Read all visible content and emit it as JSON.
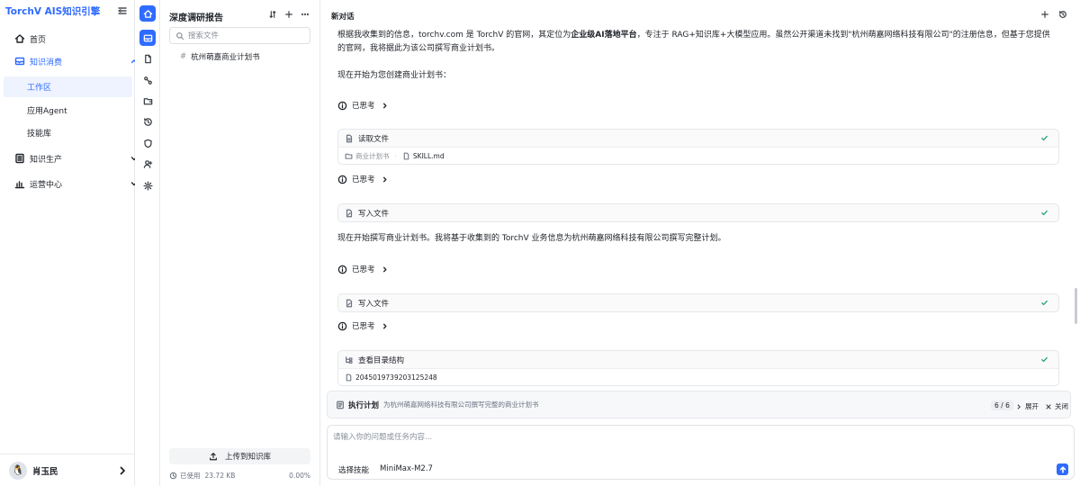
{
  "app": {
    "title": "TorchV AIS知识引擎"
  },
  "nav": {
    "home": "首页",
    "knowledge_consume": "知识消费",
    "sub_items": [
      "工作区",
      "应用Agent",
      "技能库"
    ],
    "knowledge_produce": "知识生产",
    "ops_center": "运营中心"
  },
  "user": {
    "name": "肖玉民",
    "avatar_glyph": "🐧"
  },
  "file_panel": {
    "title": "深度调研报告",
    "search_placeholder": "搜索文件",
    "files": [
      {
        "name": "杭州萌嘉商业计划书"
      }
    ],
    "upload_label": "上传到知识库",
    "usage_label": "已使用",
    "usage_size": "23.72 KB",
    "usage_percent": "0.00%"
  },
  "chat": {
    "title": "新对话",
    "msg1_pre": "根据我收集到的信息，torchv.com 是 TorchV 的官网，其定位为",
    "msg1_bold": "企业级AI落地平台",
    "msg1_post": "，专注于 RAG+知识库+大模型应用。虽然公开渠道未找到\"杭州萌嘉网络科技有限公司\"的注册信息，但基于您提供的官网，我将据此为该公司撰写商业计划书。",
    "msg2": "现在开始为您创建商业计划书：",
    "thought_label": "已思考",
    "tool_read": "读取文件",
    "read_folder": "商业计划书",
    "read_file": "SKILL.md",
    "tool_write": "写入文件",
    "msg3": "现在开始撰写商业计划书。我将基于收集到的 TorchV 业务信息为杭州萌嘉网络科技有限公司撰写完整计划。",
    "tool_dir": "查看目录结构",
    "dir_file": "2045019739203125248"
  },
  "plan": {
    "title": "执行计划",
    "desc": "为杭州萌嘉网络科技有限公司撰写完整的商业计划书",
    "count": "6 / 6",
    "expand": "展开",
    "close": "关闭"
  },
  "input": {
    "placeholder": "请输入你的问题或任务内容...",
    "skill_label": "选择技能",
    "model_label": "MiniMax-M2.7"
  },
  "colors": {
    "accent": "#2f6bff",
    "success": "#22a06b"
  },
  "icons": [
    "home-icon",
    "book-icon",
    "list-icon",
    "user-icon",
    "chart-icon",
    "shield-icon",
    "gear-icon",
    "history-icon",
    "plus-icon",
    "check-icon",
    "send-icon"
  ]
}
